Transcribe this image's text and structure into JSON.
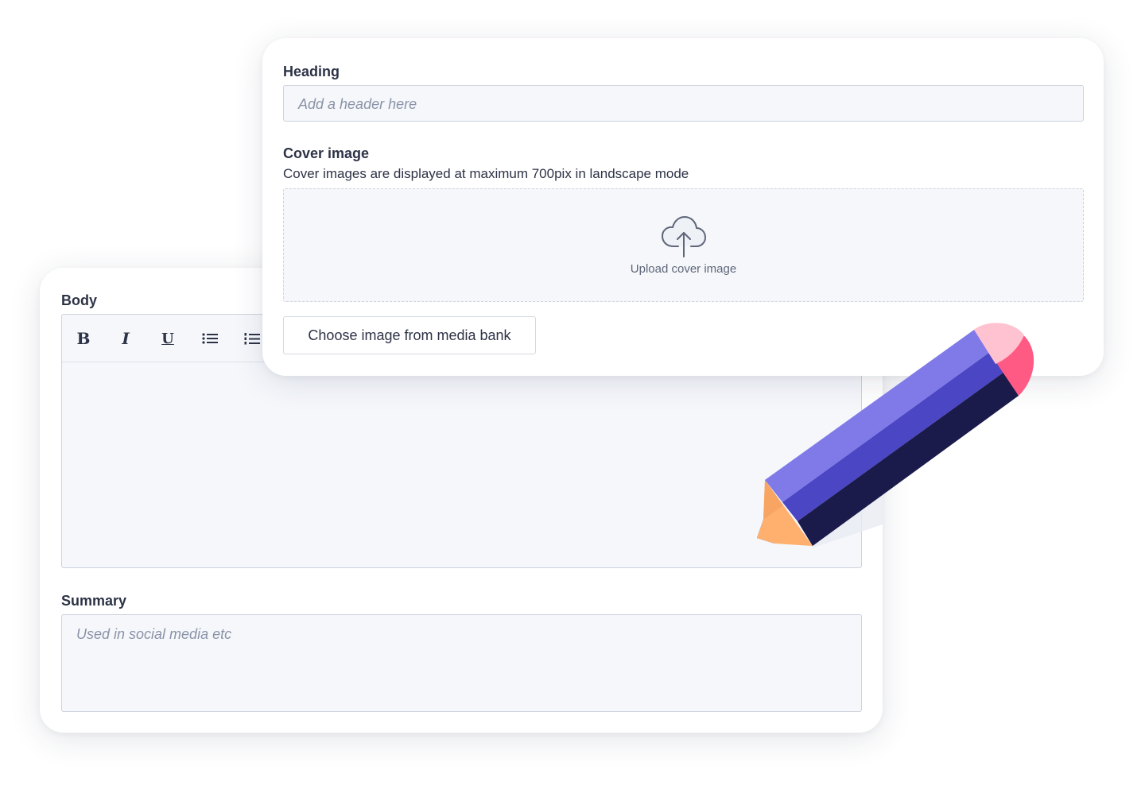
{
  "colors": {
    "background": "#ffffff",
    "card": "#ffffff",
    "field_background": "#f5f7fb",
    "field_border": "#cdd2dc",
    "text": "#2d3346",
    "placeholder": "#8a93a6",
    "pencil_light": "#7f7ae8",
    "pencil_mid": "#4b46c4",
    "pencil_dark": "#1a1a4b",
    "pencil_eraser": "#ff5a84",
    "pencil_eraser_light": "#ffc2d0",
    "pencil_wood": "#ffb06e"
  },
  "cover_form": {
    "heading_label": "Heading",
    "heading_placeholder": "Add a header here",
    "cover_label": "Cover image",
    "cover_hint": "Cover images are displayed at maximum 700pix in landscape mode",
    "upload_icon": "cloud-upload-icon",
    "upload_label": "Upload cover image",
    "media_bank_button": "Choose image from media bank"
  },
  "content_form": {
    "body_label": "Body",
    "toolbar": [
      {
        "name": "bold",
        "label": "B",
        "icon": "bold-icon"
      },
      {
        "name": "italic",
        "label": "I",
        "icon": "italic-icon"
      },
      {
        "name": "underline",
        "label": "U",
        "icon": "underline-icon"
      },
      {
        "name": "bullet-list",
        "icon": "bullet-list-icon"
      },
      {
        "name": "numbered-list",
        "icon": "numbered-list-icon"
      }
    ],
    "summary_label": "Summary",
    "summary_placeholder": "Used in social media etc"
  },
  "decoration": {
    "icon": "pencil-icon"
  }
}
